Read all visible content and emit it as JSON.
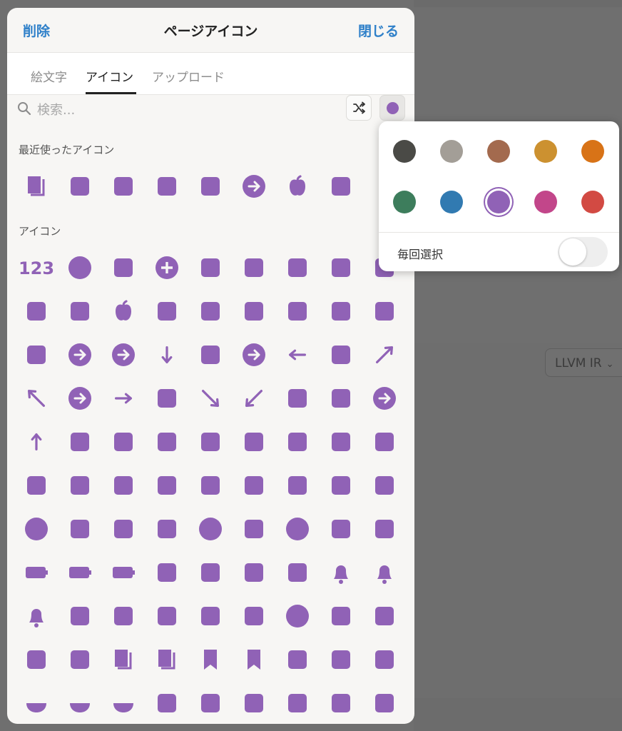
{
  "background": {
    "language_selector": "LLVM IR"
  },
  "header": {
    "delete_label": "削除",
    "title": "ページアイコン",
    "close_label": "閉じる"
  },
  "tabs": [
    {
      "label": "絵文字",
      "active": false
    },
    {
      "label": "アイコン",
      "active": true
    },
    {
      "label": "アップロード",
      "active": false
    }
  ],
  "search": {
    "placeholder": "検索...",
    "value": ""
  },
  "selected_color": "#9062b6",
  "sections": {
    "recent_title": "最近使ったアイコン",
    "icons_title": "アイコン"
  },
  "recent_icons": [
    "copy-icon",
    "hierarchy-icon",
    "gamepad-icon",
    "ambulance-icon",
    "carrot-icon",
    "arrow-right-circle-icon",
    "apple-icon",
    "arrow-up-right-square-icon"
  ],
  "icons": [
    [
      "123-icon",
      "accessibility-icon",
      "chart-line-icon",
      "plus-circle-icon",
      "airplane-icon",
      "alarm-clock-icon",
      "alert-bubble-icon",
      "alien-icon",
      "alien-monster-icon"
    ],
    [
      "ambulance-icon",
      "anchor-icon",
      "apple-icon",
      "apron-icon",
      "aquarius-icon",
      "arch-bridge-icon",
      "archery-icon",
      "archive-icon",
      "aries-icon"
    ],
    [
      "arrival-icon",
      "arrow-down-circle-outline-icon",
      "arrow-down-circle-icon",
      "arrow-down-icon",
      "arrow-down-to-line-icon",
      "arrow-left-circle-icon",
      "arrow-left-icon",
      "arrow-left-to-line-icon",
      "arrow-up-right-icon"
    ],
    [
      "arrow-up-left-icon",
      "arrow-right-circle-icon",
      "arrow-right-icon",
      "arrow-right-to-line-icon",
      "arrow-down-right-icon",
      "arrow-down-left-icon",
      "arrow-turn-left-icon",
      "arrow-turn-right-icon",
      "arrow-up-circle-icon"
    ],
    [
      "arrow-up-icon",
      "arrow-up-to-line-icon",
      "arrows-horizontal-icon",
      "arrows-diagonal-icon",
      "arrows-swap-icon",
      "arrows-vertical-icon",
      "artboard-icon",
      "asterisk-icon",
      "atm-icon"
    ],
    [
      "attachment-icon",
      "avocado-icon",
      "baby-icon",
      "baby-bottle-icon",
      "backpack-icon",
      "arrow-left-bold-icon",
      "badge-icon",
      "bag-tray-icon",
      "baggage-icon"
    ],
    [
      "balloon-icon",
      "banana-icon",
      "barcode-icon",
      "barricade-icon",
      "baseball-icon",
      "cap-icon",
      "basketball-icon",
      "bathtub-icon",
      "bathtub-shower-icon"
    ],
    [
      "battery-icon",
      "battery-plug-icon",
      "battery-charging-icon",
      "bed-icon",
      "bee-icon",
      "wine-glass-icon",
      "wine-bottle-icon",
      "bell-icon",
      "bell-badge-icon"
    ],
    [
      "bell-slash-icon",
      "bicycle-trailer-icon",
      "bicycle-icon",
      "bikini-icon",
      "binoculars-icon",
      "stethoscope-icon",
      "bluetooth-icon",
      "boarding-pass-icon",
      "boat-icon"
    ],
    [
      "bomb-icon",
      "bone-icon",
      "book-open-icon",
      "book-icon",
      "bookmark-icon",
      "bookmark-outline-icon",
      "boombox-icon",
      "boot-icon",
      "arrow-fat-right-icon"
    ],
    [
      "bowl-icon",
      "rice-bowl-icon",
      "bowling-icon",
      "bra-icon",
      "brain-head-icon",
      "branch-merge-icon",
      "git-branch-icon",
      "git-commit-icon",
      "git-fork-icon"
    ]
  ],
  "color_palette": [
    "#4a4a46",
    "#a39e97",
    "#a36a4e",
    "#cc9130",
    "#d87317",
    "#3d7d5c",
    "#317ab1",
    "#9062b6",
    "#c2468a",
    "#d24a43"
  ],
  "color_popover": {
    "always_choose_label": "毎回選択",
    "always_choose_on": false
  }
}
